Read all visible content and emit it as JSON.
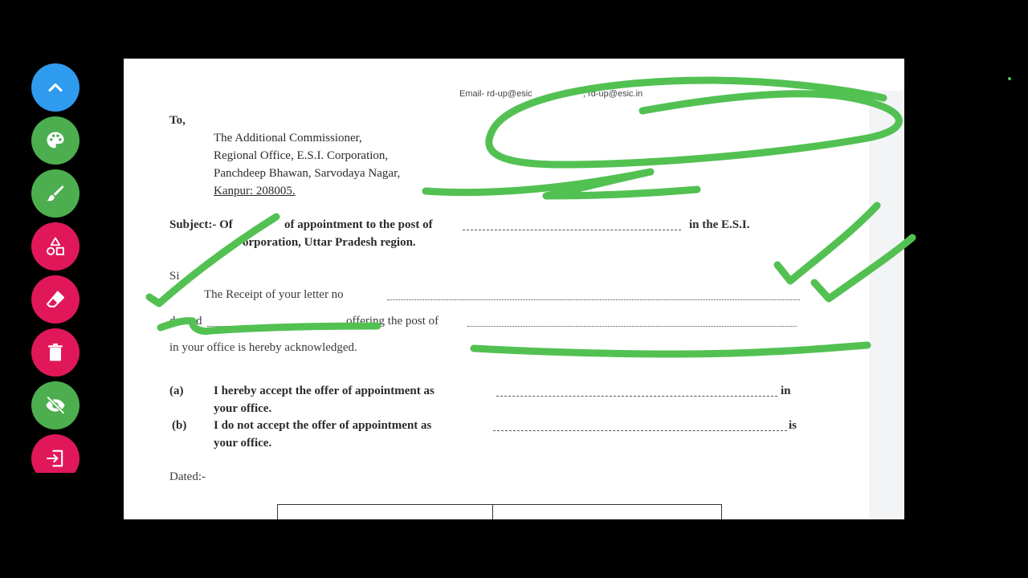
{
  "colors": {
    "background": "#000000",
    "page": "#ffffff",
    "ink_annotation": "#52c152",
    "toolbar_blue": "#2f9bef",
    "toolbar_green": "#4cae4f",
    "toolbar_pink": "#e0185a"
  },
  "toolbar": {
    "buttons": [
      {
        "icon": "chevron-up-icon",
        "color": "#2f9bef"
      },
      {
        "icon": "palette-icon",
        "color": "#4cae4f"
      },
      {
        "icon": "brush-icon",
        "color": "#4cae4f"
      },
      {
        "icon": "shapes-icon",
        "color": "#e0185a"
      },
      {
        "icon": "eraser-icon",
        "color": "#e0185a"
      },
      {
        "icon": "trash-icon",
        "color": "#e0185a"
      },
      {
        "icon": "eye-off-icon",
        "color": "#4cae4f"
      },
      {
        "icon": "exit-icon",
        "color": "#e0185a"
      }
    ]
  },
  "document": {
    "email_line": "Email- rd-up@esic",
    "email_line_tail": ", rd-up@esic.in",
    "to": "To,",
    "address": [
      "The Additional Commissioner,",
      "Regional Office, E.S.I. Corporation,",
      "Panchdeep Bhawan, Sarvodaya Nagar,",
      "Kanpur: 208005."
    ],
    "subject_label": "Subject:- Of",
    "subject_text": "of appointment to the post of",
    "subject_tail": "in the E.S.I.",
    "subject_line2": "orporation, Uttar Pradesh region.",
    "salutation": "Si",
    "receipt_text": "The Receipt of your letter no",
    "dated_label": "da",
    "dated_label2": "d",
    "offering_text": "offering the post of",
    "ack_text": "in your office is hereby acknowledged.",
    "option_a_label": "(a)",
    "option_a_text": "I hereby accept the offer of appointment as",
    "option_a_tail": "in",
    "option_a_line2": "your office.",
    "option_b_label": "(b)",
    "option_b_text": "I do not accept the offer of appointment as",
    "option_b_tail": "is",
    "option_b_line2": "your office.",
    "dated_footer": "Dated:-"
  }
}
